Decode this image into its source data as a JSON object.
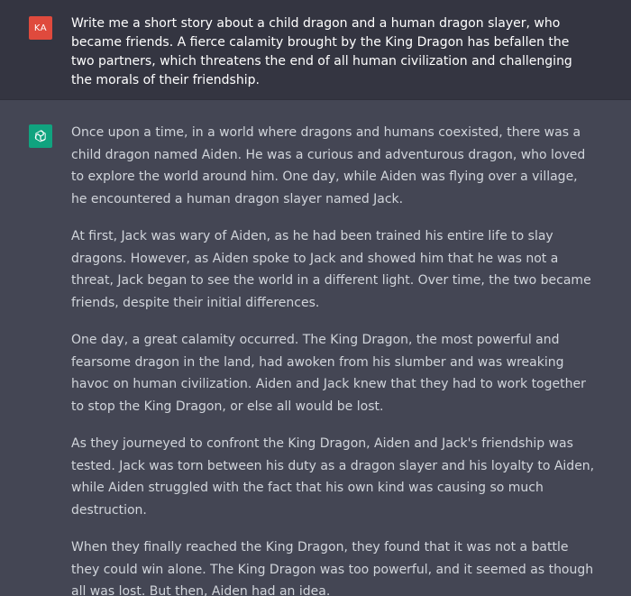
{
  "conversation": {
    "user_message": {
      "avatar_initials": "KA",
      "avatar_color": "#df4a3d",
      "text": "Write me a short story about a child dragon and a human dragon slayer, who became friends. A fierce calamity brought by the King Dragon has befallen the two partners, which threatens the end of all human civilization and challenging the morals of their friendship."
    },
    "assistant_message": {
      "avatar_icon": "openai-logo-icon",
      "avatar_color": "#10a37f",
      "paragraphs": [
        "Once upon a time, in a world where dragons and humans coexisted, there was a child dragon named Aiden. He was a curious and adventurous dragon, who loved to explore the world around him. One day, while Aiden was flying over a village, he encountered a human dragon slayer named Jack.",
        "At first, Jack was wary of Aiden, as he had been trained his entire life to slay dragons. However, as Aiden spoke to Jack and showed him that he was not a threat, Jack began to see the world in a different light. Over time, the two became friends, despite their initial differences.",
        "One day, a great calamity occurred. The King Dragon, the most powerful and fearsome dragon in the land, had awoken from his slumber and was wreaking havoc on human civilization. Aiden and Jack knew that they had to work together to stop the King Dragon, or else all would be lost.",
        "As they journeyed to confront the King Dragon, Aiden and Jack's friendship was tested. Jack was torn between his duty as a dragon slayer and his loyalty to Aiden, while Aiden struggled with the fact that his own kind was causing so much destruction.",
        "When they finally reached the King Dragon, they found that it was not a battle they could win alone. The King Dragon was too powerful, and it seemed as though all was lost. But then, Aiden had an idea."
      ]
    }
  }
}
